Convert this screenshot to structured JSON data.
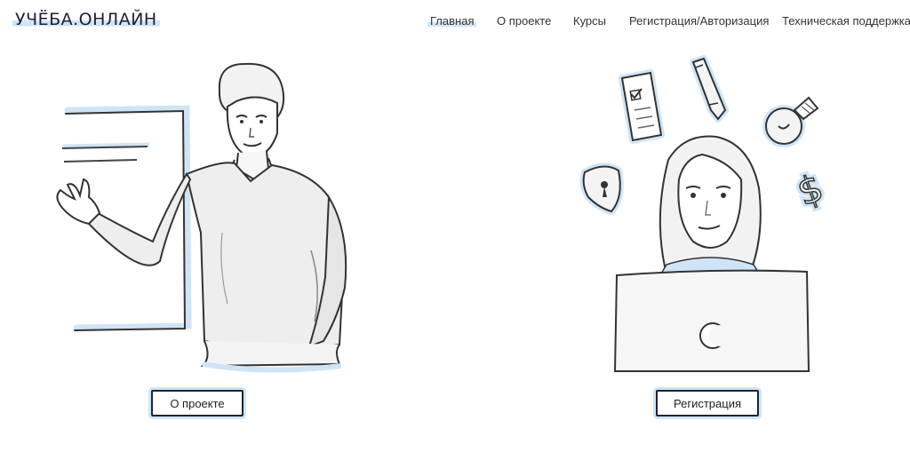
{
  "header": {
    "logo": "УЧЁБА.ОНЛАЙН",
    "nav": [
      {
        "label": "Главная",
        "active": true
      },
      {
        "label": "О проекте",
        "active": false
      },
      {
        "label": "Курсы",
        "active": false
      },
      {
        "label": "Регистрация/Авторизация",
        "active": false
      },
      {
        "label": "Техническая поддержка",
        "active": false
      }
    ]
  },
  "hero": {
    "about_button": "О проекте",
    "register_button": "Регистрация"
  },
  "colors": {
    "accent": "#cfe5f7",
    "ink": "#1d2233"
  }
}
